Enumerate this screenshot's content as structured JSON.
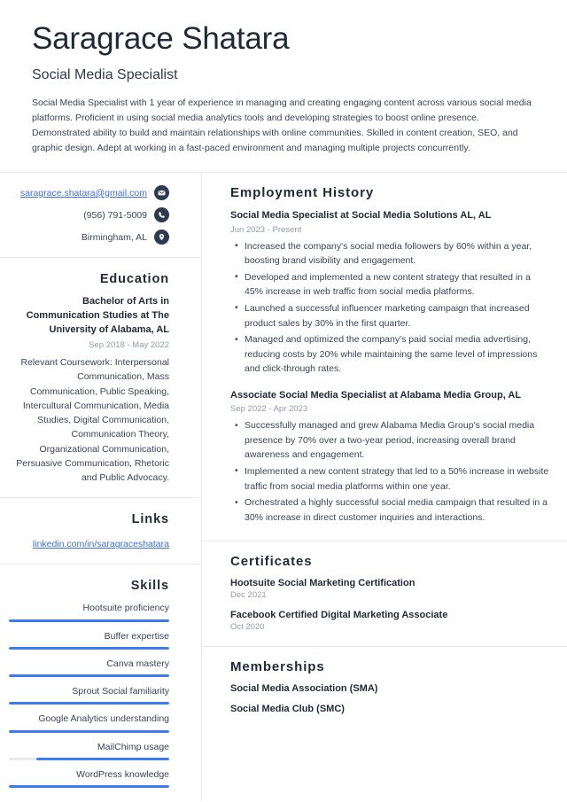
{
  "header": {
    "name": "Saragrace Shatara",
    "title": "Social Media Specialist",
    "summary": "Social Media Specialist with 1 year of experience in managing and creating engaging content across various social media platforms. Proficient in using social media analytics tools and developing strategies to boost online presence. Demonstrated ability to build and maintain relationships with online communities. Skilled in content creation, SEO, and graphic design. Adept at working in a fast-paced environment and managing multiple projects concurrently."
  },
  "contact": {
    "email": "saragrace.shatara@gmail.com",
    "email_icon": "envelope-icon",
    "phone": "(956) 791-5009",
    "phone_icon": "phone-icon",
    "location": "Birmingham, AL",
    "location_icon": "location-pin-icon"
  },
  "education": {
    "heading": "Education",
    "degree": "Bachelor of Arts in Communication Studies at The University of Alabama, AL",
    "dates": "Sep 2018 - May 2022",
    "coursework": "Relevant Coursework: Interpersonal Communication, Mass Communication, Public Speaking, Intercultural Communication, Media Studies, Digital Communication, Communication Theory, Organizational Communication, Persuasive Communication, Rhetoric and Public Advocacy."
  },
  "links": {
    "heading": "Links",
    "items": [
      {
        "label": "linkedin.com/in/saragraceshatara"
      }
    ]
  },
  "skills": {
    "heading": "Skills",
    "items": [
      {
        "label": "Hootsuite proficiency",
        "level": 100
      },
      {
        "label": "Buffer expertise",
        "level": 100
      },
      {
        "label": "Canva mastery",
        "level": 100
      },
      {
        "label": "Sprout Social familiarity",
        "level": 100
      },
      {
        "label": "Google Analytics understanding",
        "level": 100
      },
      {
        "label": "MailChimp usage",
        "level": 83
      },
      {
        "label": "WordPress knowledge",
        "level": 100
      }
    ]
  },
  "employment": {
    "heading": "Employment History",
    "jobs": [
      {
        "role": "Social Media Specialist at Social Media Solutions AL, AL",
        "dates": "Jun 2023 - Present",
        "bullets": [
          "Increased the company's social media followers by 60% within a year, boosting brand visibility and engagement.",
          "Developed and implemented a new content strategy that resulted in a 45% increase in web traffic from social media platforms.",
          "Launched a successful influencer marketing campaign that increased product sales by 30% in the first quarter.",
          "Managed and optimized the company's paid social media advertising, reducing costs by 20% while maintaining the same level of impressions and click-through rates."
        ]
      },
      {
        "role": "Associate Social Media Specialist at Alabama Media Group, AL",
        "dates": "Sep 2022 - Apr 2023",
        "bullets": [
          "Successfully managed and grew Alabama Media Group's social media presence by 70% over a two-year period, increasing overall brand awareness and engagement.",
          "Implemented a new content strategy that led to a 50% increase in website traffic from social media platforms within one year.",
          "Orchestrated a highly successful social media campaign that resulted in a 30% increase in direct customer inquiries and interactions."
        ]
      }
    ]
  },
  "certificates": {
    "heading": "Certificates",
    "items": [
      {
        "name": "Hootsuite Social Marketing Certification",
        "date": "Dec 2021"
      },
      {
        "name": "Facebook Certified Digital Marketing Associate",
        "date": "Oct 2020"
      }
    ]
  },
  "memberships": {
    "heading": "Memberships",
    "items": [
      {
        "name": "Social Media Association (SMA)"
      },
      {
        "name": "Social Media Club (SMC)"
      }
    ]
  },
  "colors": {
    "accent": "#3d7cf0",
    "heading": "#1f2937",
    "body_text": "#39435a",
    "muted": "#9099a8",
    "link": "#3f6fd1",
    "icon_bg": "#2e3a4d",
    "divider": "#e6e8ec"
  }
}
